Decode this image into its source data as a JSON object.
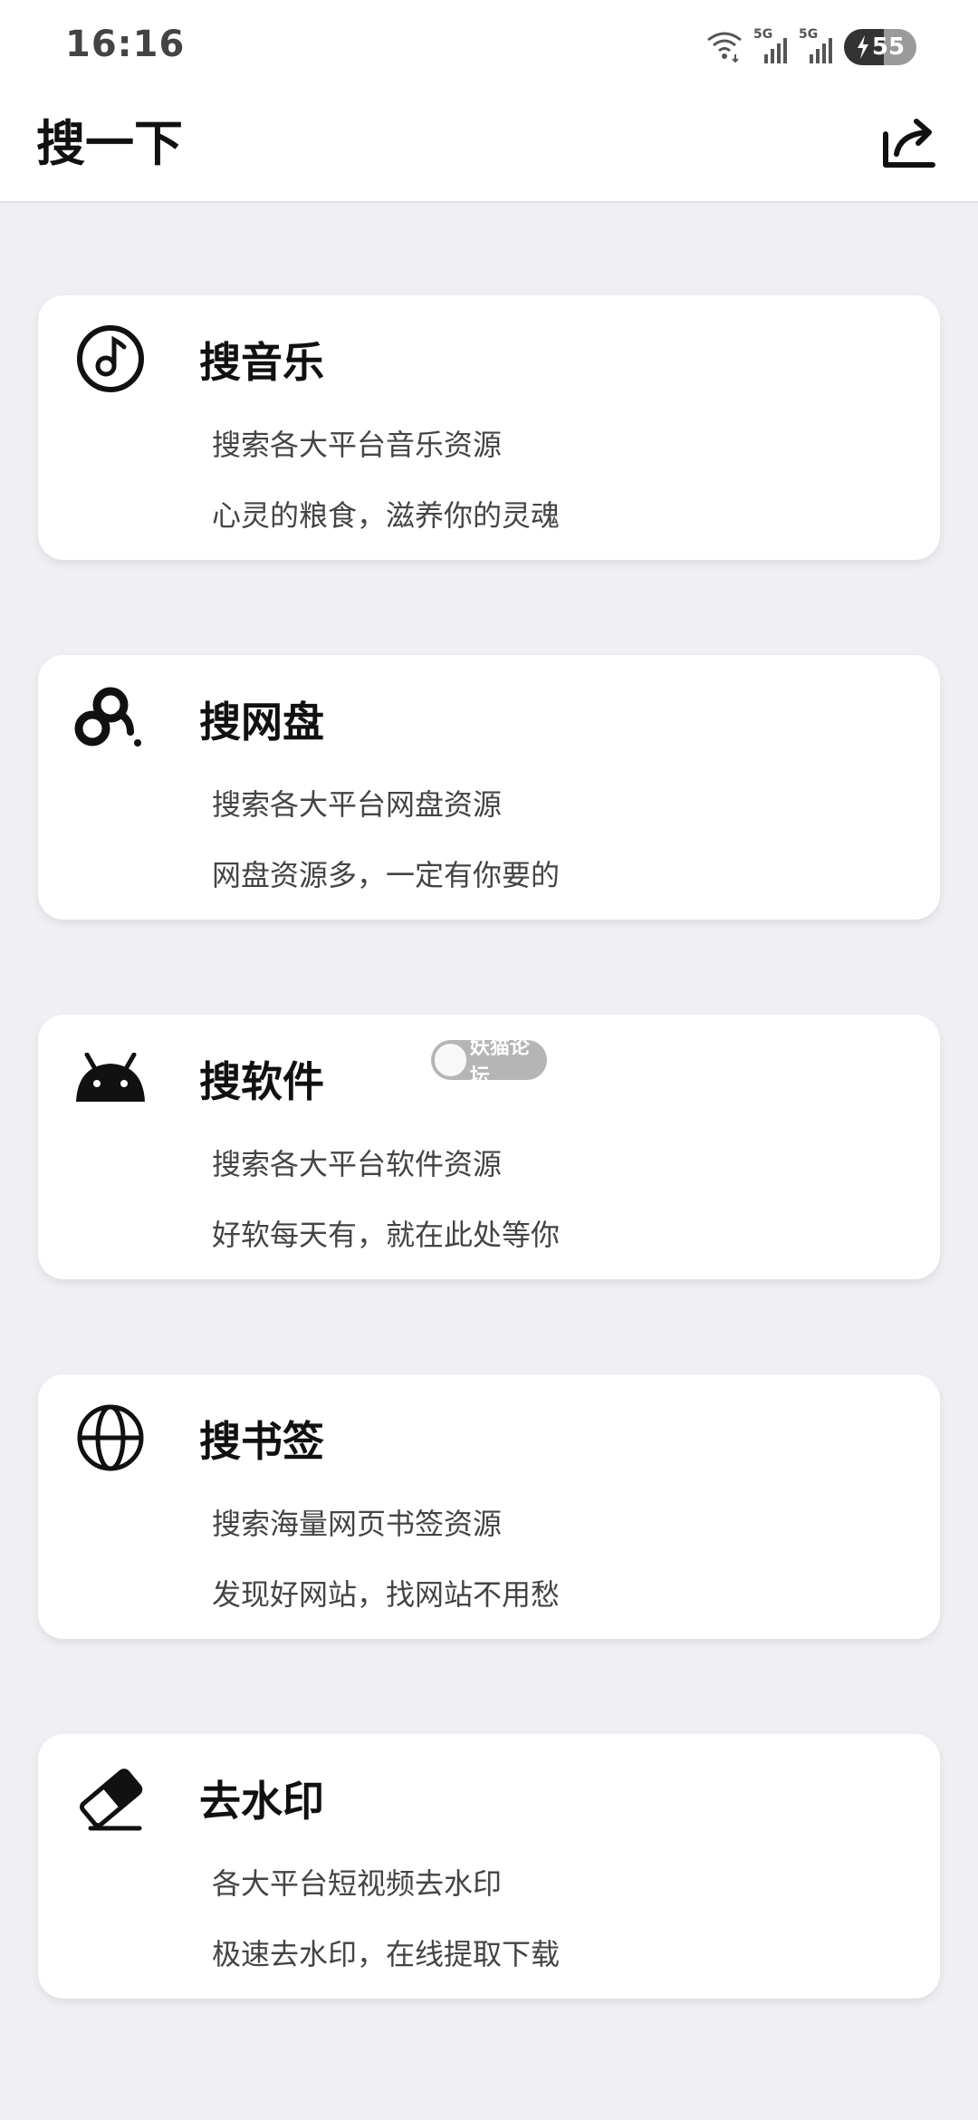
{
  "status_bar": {
    "time": "16:16",
    "net1": "5G",
    "net2": "5G",
    "battery": "55",
    "icons": [
      "wifi-icon",
      "signal-icon",
      "signal-icon",
      "battery-charging-icon"
    ]
  },
  "app_bar": {
    "title": "搜一下",
    "share_icon": "share-icon"
  },
  "cards": [
    {
      "icon": "music-note-icon",
      "title": "搜音乐",
      "line1": "搜索各大平台音乐资源",
      "line2": "心灵的粮食，滋养你的灵魂"
    },
    {
      "icon": "cloud-drive-icon",
      "title": "搜网盘",
      "line1": "搜索各大平台网盘资源",
      "line2": "网盘资源多，一定有你要的"
    },
    {
      "icon": "android-icon",
      "title": "搜软件",
      "line1": "搜索各大平台软件资源",
      "line2": "好软每天有，就在此处等你"
    },
    {
      "icon": "globe-icon",
      "title": "搜书签",
      "line1": "搜索海量网页书签资源",
      "line2": "发现好网站，找网站不用愁"
    },
    {
      "icon": "eraser-icon",
      "title": "去水印",
      "line1": "各大平台短视频去水印",
      "line2": "极速去水印，在线提取下载"
    }
  ],
  "watermark": {
    "text": "妖猫论坛"
  },
  "colors": {
    "background": "#efeff4",
    "card": "#ffffff",
    "text_primary": "#111111",
    "text_secondary": "#444444"
  }
}
